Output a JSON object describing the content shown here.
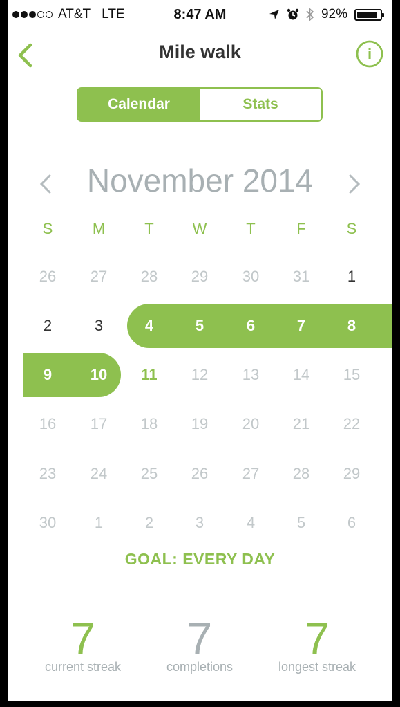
{
  "status_bar": {
    "carrier": "AT&T",
    "network": "LTE",
    "time": "8:47 AM",
    "battery": "92%",
    "battery_level": 0.92,
    "signal_dots_filled": 3,
    "signal_dots_total": 5,
    "icons": [
      "location-arrow-icon",
      "alarm-icon",
      "bluetooth-icon",
      "battery-icon"
    ]
  },
  "nav": {
    "title": "Mile walk",
    "back_icon": "chevron-left-icon",
    "info_icon": "info-icon",
    "info_glyph": "i"
  },
  "segments": {
    "calendar": "Calendar",
    "stats": "Stats",
    "selected": "Calendar"
  },
  "calendar": {
    "month": "November 2014",
    "prev_icon": "chevron-left-icon",
    "next_icon": "chevron-right-icon",
    "weekdays": [
      "S",
      "M",
      "T",
      "W",
      "T",
      "F",
      "S"
    ],
    "weeks": [
      [
        "26",
        "27",
        "28",
        "29",
        "30",
        "31",
        "1"
      ],
      [
        "2",
        "3",
        "4",
        "5",
        "6",
        "7",
        "8"
      ],
      [
        "9",
        "10",
        "11",
        "12",
        "13",
        "14",
        "15"
      ],
      [
        "16",
        "17",
        "18",
        "19",
        "20",
        "21",
        "22"
      ],
      [
        "23",
        "24",
        "25",
        "26",
        "27",
        "28",
        "29"
      ],
      [
        "30",
        "1",
        "2",
        "3",
        "4",
        "5",
        "6"
      ]
    ],
    "completed_days": [
      "4",
      "5",
      "6",
      "7",
      "8",
      "9",
      "10"
    ],
    "today": "11"
  },
  "goal": "GOAL: EVERY DAY",
  "stats": [
    {
      "value": "7",
      "label": "current streak"
    },
    {
      "value": "7",
      "label": "completions"
    },
    {
      "value": "7",
      "label": "longest streak"
    }
  ],
  "colors": {
    "accent": "#8ec04f",
    "muted": "#a8b0b3",
    "faded_day": "#c2c8ca",
    "text": "#333333"
  }
}
